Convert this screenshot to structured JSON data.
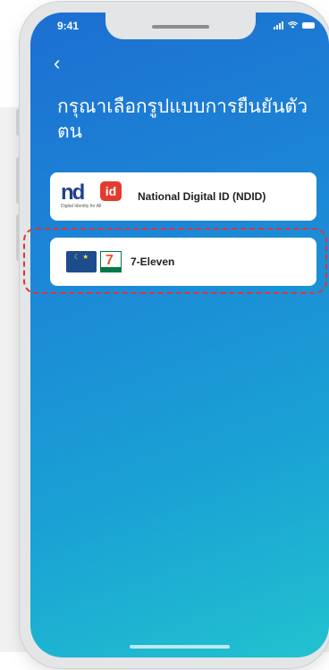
{
  "status_bar": {
    "time": "9:41"
  },
  "header": {
    "back_symbol": "‹",
    "title": "กรุณาเลือกรูปแบบการยืนยันตัวตน"
  },
  "options": [
    {
      "label": "National Digital ID (NDID)",
      "logo_main": "nd",
      "logo_badge": "id",
      "logo_tagline": "Digital Identity for All"
    },
    {
      "label": "7-Eleven",
      "logo_main": "7"
    }
  ],
  "colors": {
    "gradient_start": "#1c6fd1",
    "gradient_end": "#22c2cf",
    "highlight": "#e0323a"
  }
}
